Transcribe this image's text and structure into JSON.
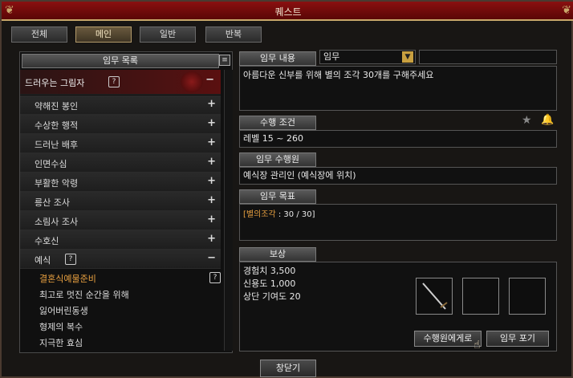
{
  "window": {
    "title": "퀘스트",
    "close_label": "×",
    "footer_button": "창닫기"
  },
  "tabs": [
    {
      "label": "전체"
    },
    {
      "label": "메인",
      "active": true
    },
    {
      "label": "일반"
    },
    {
      "label": "반복"
    }
  ],
  "quest_list": {
    "header": "임무 목록",
    "items": [
      {
        "label": "드러우는 그림자",
        "qmark": "?",
        "toggle": "−",
        "expanded": true,
        "active": true
      },
      {
        "label": "약해진 봉인",
        "toggle": "+"
      },
      {
        "label": "수상한 행적",
        "toggle": "+"
      },
      {
        "label": "드러난 배후",
        "toggle": "+"
      },
      {
        "label": "인면수심",
        "toggle": "+"
      },
      {
        "label": "부활한 악령",
        "toggle": "+"
      },
      {
        "label": "릉산 조사",
        "toggle": "+"
      },
      {
        "label": "소림사 조사",
        "toggle": "+"
      },
      {
        "label": "수호신",
        "toggle": "+"
      },
      {
        "label": "예식",
        "qmark": "?",
        "toggle": "−",
        "expanded": true
      }
    ],
    "sub_items": [
      {
        "label": "결혼식예물준비",
        "selected": true,
        "qmark": "?"
      },
      {
        "label": "최고로 멋진 순간을 위해"
      },
      {
        "label": "잃어버린동생"
      },
      {
        "label": "형제의 복수"
      },
      {
        "label": "지극한 효심"
      }
    ]
  },
  "detail": {
    "content_label": "임무 내용",
    "type_value": "임무",
    "content_text": "아름다운 신부를 위해 별의 조각 30개를 구해주세요",
    "condition_label": "수행 조건",
    "condition_text": "레벨 15 ~ 260",
    "npc_label": "임무 수행원",
    "npc_text": "예식장 관리인 (예식장에 위치)",
    "goal_label": "임무 목표",
    "goal_item": "[별의조각",
    "goal_progress": " : 30 / 30]",
    "reward_label": "보상",
    "rewards": [
      {
        "text": "경험치 3,500"
      },
      {
        "text": "신용도 1,000"
      },
      {
        "text": "상단 기여도 20"
      }
    ],
    "complete_button": "수행원에게로",
    "abandon_button": "임무 포기"
  },
  "colors": {
    "title_bg": "#7a0c0c",
    "selected_text": "#e8a040",
    "goal_item": "#e8a040",
    "goal_progress": "#e0e0e0"
  }
}
